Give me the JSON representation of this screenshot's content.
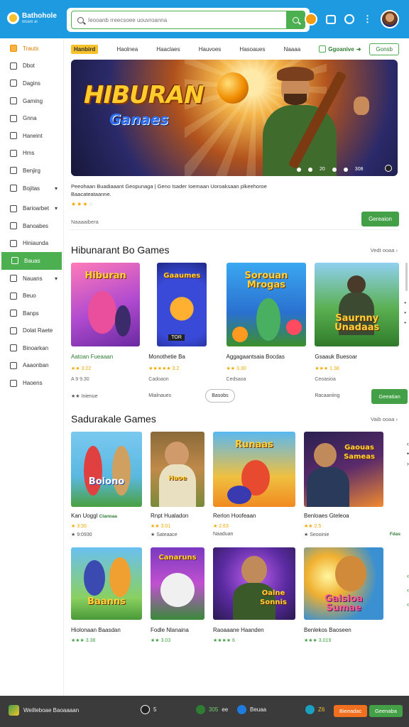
{
  "app": {
    "title": "Bathohole",
    "subtitle": "Boani ai"
  },
  "search": {
    "placeholder": "Ieooanb rreecsoee uouvroanna"
  },
  "sidebar": {
    "items": [
      {
        "label": "Trauts"
      },
      {
        "label": "Dbot"
      },
      {
        "label": "Dagins"
      },
      {
        "label": "Gaming"
      },
      {
        "label": "Gnna"
      },
      {
        "label": "Haneint"
      },
      {
        "label": "Hms"
      },
      {
        "label": "Benjirg"
      },
      {
        "label": "Bojitas"
      },
      {
        "label": "Barioarbet"
      },
      {
        "label": "Banoabes"
      },
      {
        "label": "Hiniaunda"
      },
      {
        "label": "Bauas"
      },
      {
        "label": "Nauans"
      },
      {
        "label": "Beuo"
      },
      {
        "label": "Banps"
      },
      {
        "label": "Dolat Raete"
      },
      {
        "label": "Binoarkan"
      },
      {
        "label": "Aaaonban"
      },
      {
        "label": "Haoens"
      }
    ]
  },
  "tabs": {
    "items": [
      "Hanbird",
      "Haolnea",
      "Haaclaes",
      "Hauvoes",
      "Hasoaues",
      "Naaaa"
    ],
    "more": "Ggoanive",
    "button": "Gonsb"
  },
  "hero": {
    "title": "HIBURAN",
    "subtitle": "Ganaes",
    "indicators": [
      "20",
      "308"
    ],
    "description": "Peeohaan Buadiaaant Geopunaga | Geno Isader Ioemaan Uoroaksaan plkeehoroe Baacateataanne.",
    "stars": "★★★",
    "stars_dim": "☆",
    "meta_label": "Naaaaibera",
    "button": "Gereaion"
  },
  "section1": {
    "title": "Hibunarant Bo Games",
    "view_all": "Vedt ooaa",
    "cards": [
      {
        "art_title": "Hiburan",
        "title": "Aatoan Fueaaan",
        "rating": "★★ 3:22",
        "price": "A 9 9.30",
        "foot": "★★ Inienue"
      },
      {
        "art_title": "Gaaumes",
        "art_tag": "TOR",
        "title": "Monothetie Ba",
        "rating": "★★★★★ 3.2",
        "price": "Cadoaon",
        "foot": "Mialnaues",
        "foot_button": "Basobs"
      },
      {
        "art_title": "Sorouan Mrogas",
        "title": "Aggagaantsaia Bocdas",
        "rating": "★★ 3.30",
        "price": "Cedsaoa",
        "foot": ""
      },
      {
        "art_title": "Saurnny Unadaas",
        "title": "Gsaauk Buesoar",
        "rating": "★★★ 1.38",
        "price": "Ceoasioa",
        "foot": "Racaaniing",
        "foot_button": "Geeatian"
      }
    ]
  },
  "section2": {
    "title": "Sadurakale Games",
    "view_all": "Vaib ooaa",
    "cards": [
      {
        "art_title": "Boiono",
        "title": "Kan Uoggl",
        "title_tag": "Clanoaa",
        "rating": "★ 3:30",
        "price": "★ 9:0930"
      },
      {
        "art_title": "Haoe",
        "title": "Rnpt Hualadon",
        "rating": "★★ 3.01",
        "price": "★ Sateaace"
      },
      {
        "art_title": "Runaas",
        "title": "Rerlon Hoofeaan",
        "rating": "★ 2.63",
        "price": "Naaduan"
      },
      {
        "art_title": "Gaouas Sameas",
        "title": "Benloaes Gteleoa",
        "rating": "★★ 2.5",
        "price": "★ Seooinie",
        "price_tag": "Fdas"
      },
      {
        "art_title": "Baanns",
        "title": "Hiolonaan Baasdan",
        "rating": "★★★ 3.38"
      },
      {
        "art_title": "Canaruns",
        "title": "Fodle Nlanaina",
        "rating": "★★ 3.03"
      },
      {
        "art_title": "Oalne Sonnis",
        "title": "Raoaaane Haanden",
        "rating": "★★★★ 6"
      },
      {
        "art_title": "Galsioa Sumae",
        "title": "Benlekos Baoseen",
        "rating": "★★★ 3.019"
      }
    ]
  },
  "bottombar": {
    "app_label": "Weilleboae Baoaaaan",
    "count": "5",
    "score": "305",
    "score_suffix": "ee",
    "status": "Beuaa",
    "coins": "Z6",
    "orange_button": "Bieeadac",
    "green_button": "Geenaba"
  },
  "colors": {
    "topbar": "#1e9be0",
    "accent_green": "#43a047",
    "accent_yellow": "#f6c12a",
    "bottombar": "#3b3b3b"
  }
}
